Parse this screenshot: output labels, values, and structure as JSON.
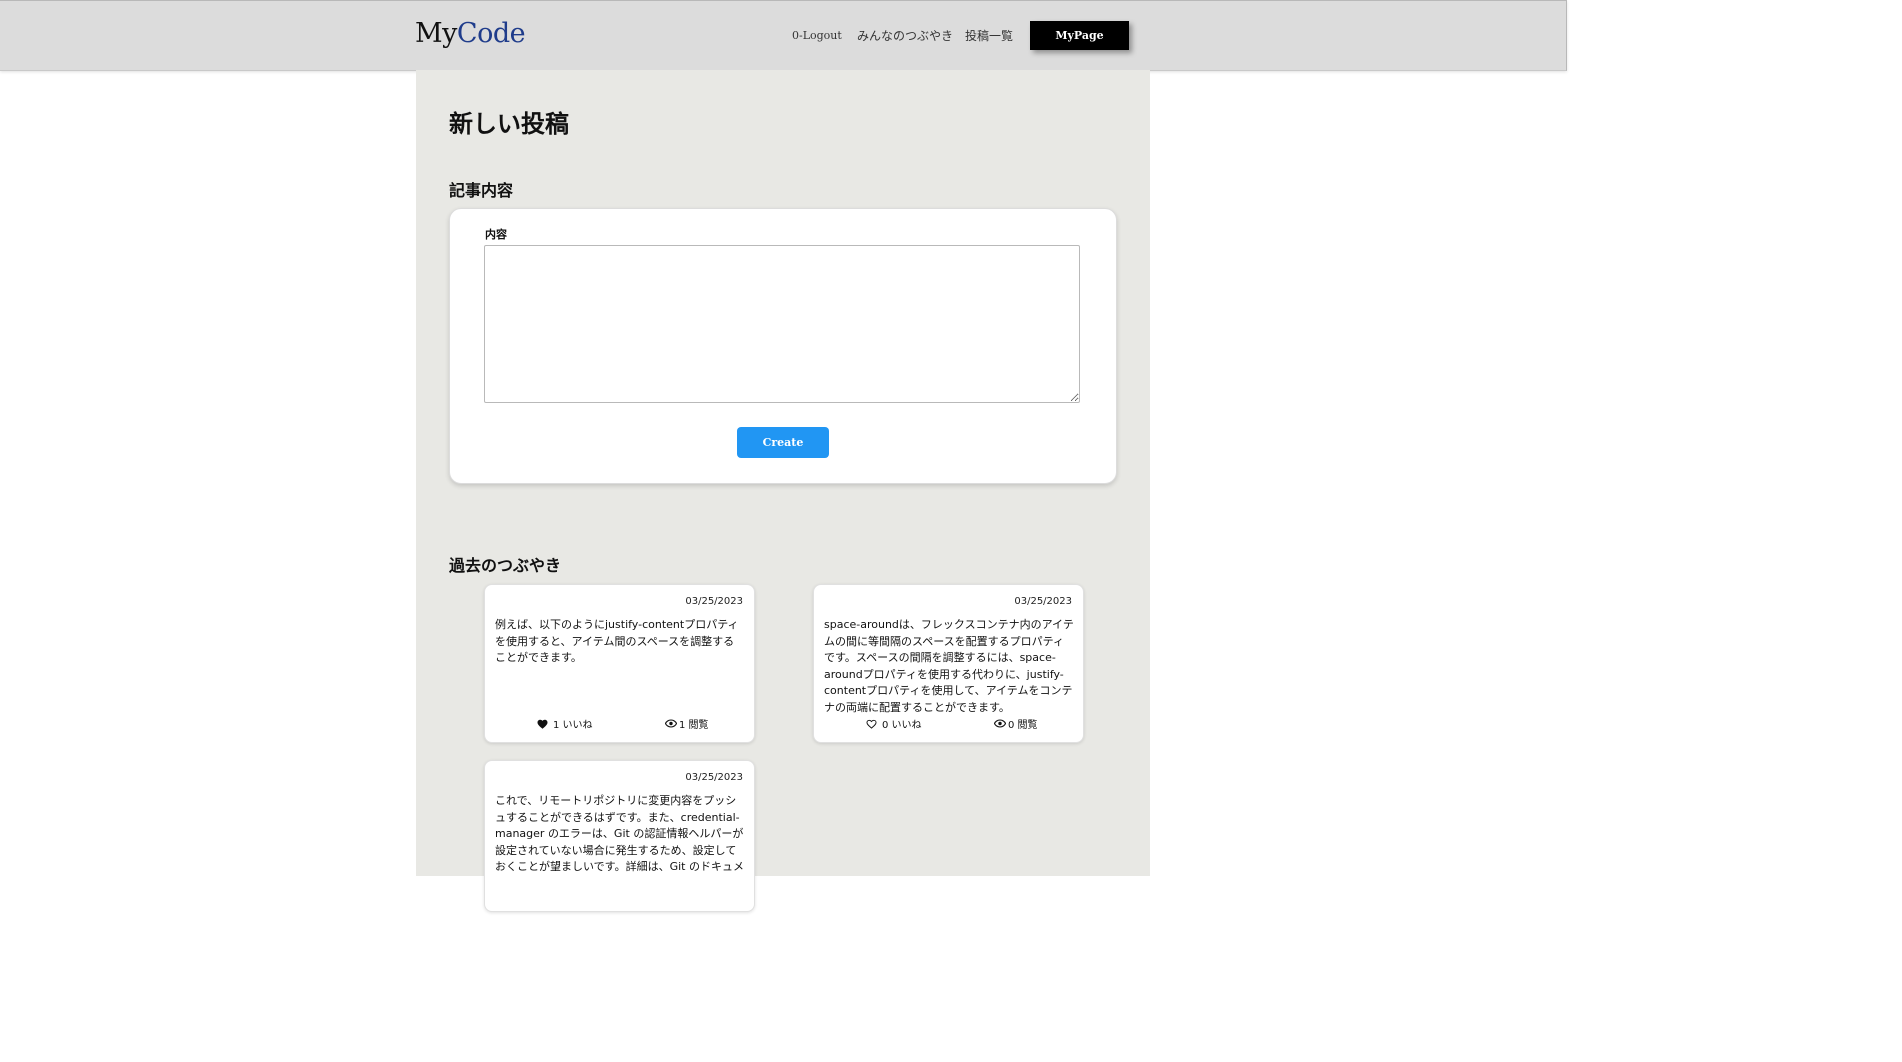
{
  "header": {
    "logo_part1": "My",
    "logo_part2": "Code",
    "logout_label": "0-Logout",
    "minna_label": "みんなのつぶやき",
    "posts_label": "投稿一覧",
    "mypage_label": "MyPage"
  },
  "page": {
    "title": "新しい投稿",
    "article_section": "記事内容",
    "content_label": "内容",
    "content_value": "",
    "create_label": "Create",
    "past_section": "過去のつぶやき"
  },
  "posts": [
    {
      "date": "03/25/2023",
      "body": "例えば、以下のようにjustify-contentプロパティを使用すると、アイテム間のスペースを調整することができます。",
      "likes": "1 いいね",
      "views": "1 閲覧",
      "liked": true
    },
    {
      "date": "03/25/2023",
      "body": "space-aroundは、フレックスコンテナ内のアイテムの間に等間隔のスペースを配置するプロパティです。スペースの間隔を調整するには、space-aroundプロパティを使用する代わりに、justify-contentプロパティを使用して、アイテムをコンテナの両端に配置することができます。",
      "likes": "0 いいね",
      "views": "0 閲覧",
      "liked": false
    },
    {
      "date": "03/25/2023",
      "body": "これで、リモートリポジトリに変更内容をプッシュすることができるはずです。また、credential-manager のエラーは、Git の認証情報ヘルパーが設定されていない場合に発生するため、設定しておくことが望ましいです。詳細は、Git のドキュメ",
      "likes": "",
      "views": "",
      "liked": false
    }
  ],
  "colors": {
    "header_bg": "#dcdcdc",
    "main_bg": "#e8e8e4",
    "logo_accent": "#1f3c8b",
    "create_button": "#2196f3",
    "mypage_button": "#000000"
  },
  "icons": {
    "like_filled": "heart-filled-icon",
    "like_empty": "heart-outline-icon",
    "views": "eye-icon"
  }
}
